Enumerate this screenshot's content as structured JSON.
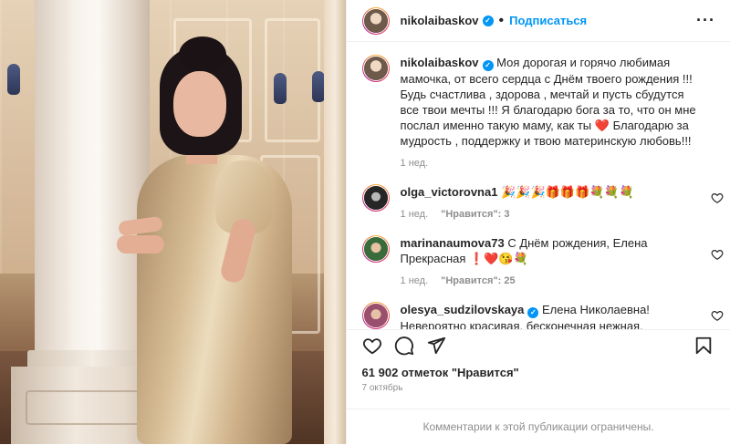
{
  "header": {
    "username": "nikolaibaskov",
    "verified_mark": "✓",
    "separator": "•",
    "follow_label": "Подписаться",
    "more_label": "···"
  },
  "caption": {
    "username": "nikolaibaskov",
    "text_part1": "Моя дорогая и горячо любимая мамочка, от всего сердца с Днём твоего рождения !!! Будь счастлива , здорова , мечтай и пусть сбудутся все твои мечты !!! Я благодарю бога за то, что он мне послал именно такую маму, как ты",
    "heart": "❤️",
    "text_part2": "Благодарю за мудрость , поддержку и твою материнскую любовь!!!",
    "time": "1 нед."
  },
  "comments": [
    {
      "username": "olga_victorovna1",
      "text": "🎉🎉🎉🎁🎁🎁💐💐💐",
      "time": "1 нед.",
      "likes": "\"Нравится\": 3"
    },
    {
      "username": "marinanaumova73",
      "text": "С Днём рождения, Елена Прекрасная ❗️❤️😘💐",
      "time": "1 нед.",
      "likes": "\"Нравится\": 25"
    },
    {
      "username": "olesya_sudzilovskaya",
      "text": "Елена Николаевна! Невероятно красивая, бесконечная нежная, жизнелюбивая",
      "time": "",
      "likes": ""
    }
  ],
  "stats": {
    "likes_total": "61 902 отметок \"Нравится\"",
    "date": "7 октябрь"
  },
  "footer": {
    "notice": "Комментарии к этой публикации ограничены."
  },
  "icons": {
    "like": "heart-icon",
    "comment": "comment-icon",
    "share": "share-icon",
    "save": "bookmark-icon"
  },
  "colors": {
    "link_blue": "#0095f6",
    "muted": "#8e8e8e",
    "text": "#262626",
    "red_heart": "#ed4956"
  }
}
